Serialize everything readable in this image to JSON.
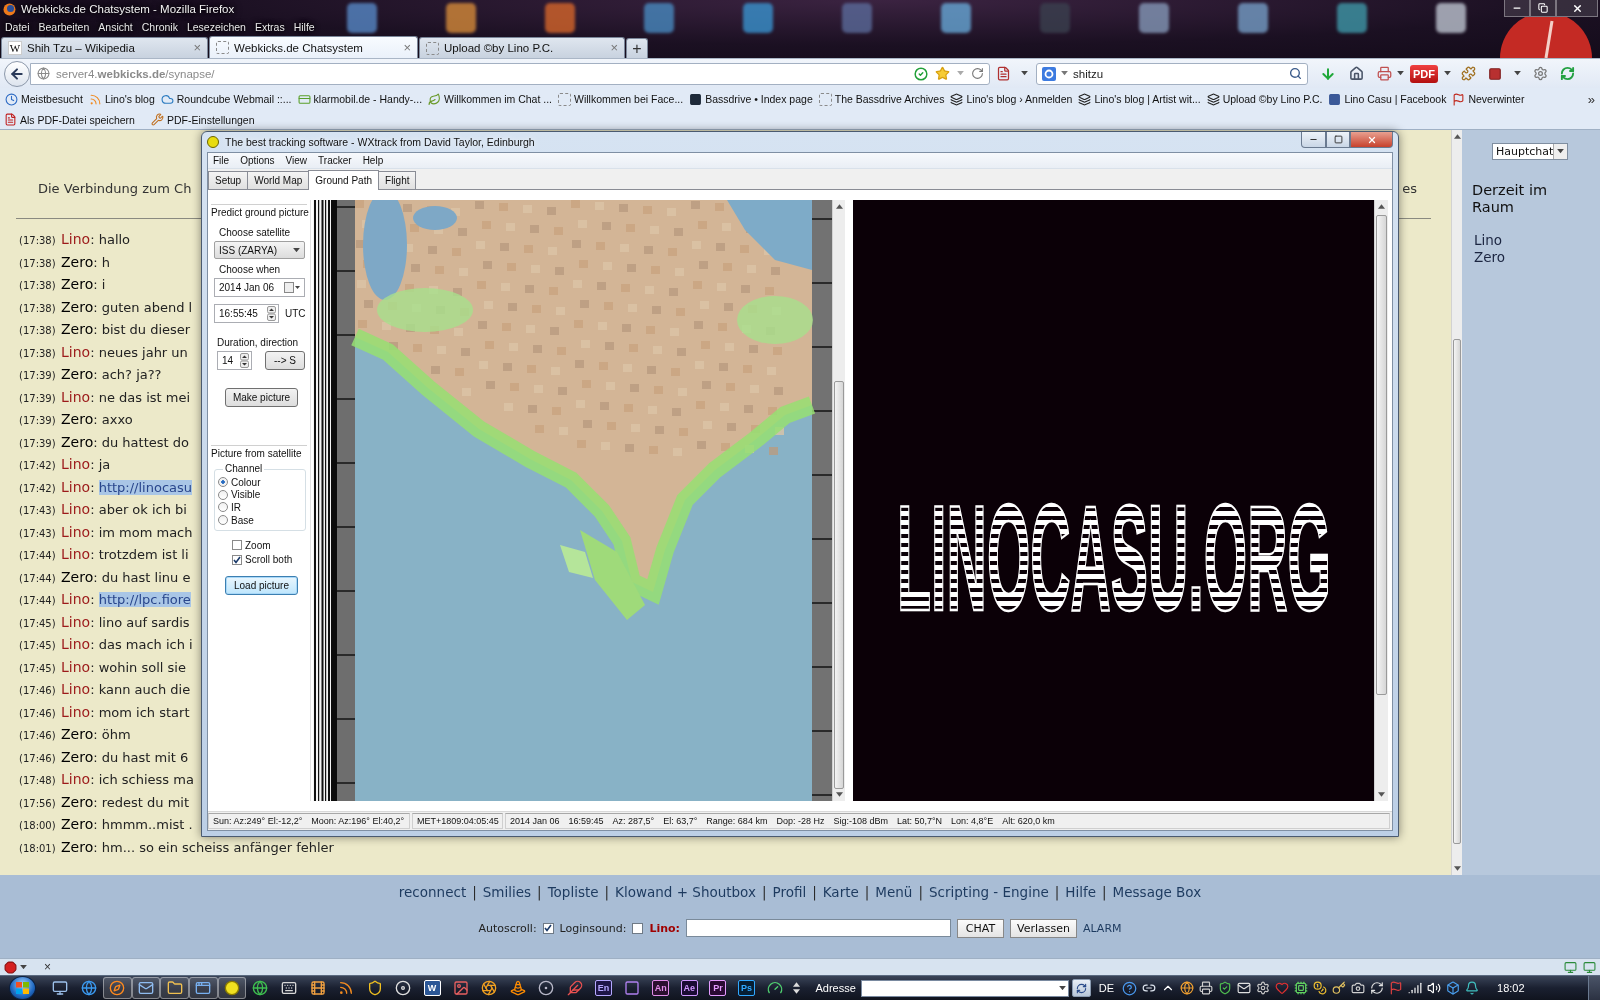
{
  "window": {
    "title": "Webkicks.de Chatsystem - Mozilla Firefox"
  },
  "menu": [
    "Datei",
    "Bearbeiten",
    "Ansicht",
    "Chronik",
    "Lesezeichen",
    "Extras",
    "Hilfe"
  ],
  "tabs": [
    {
      "favicon": "W",
      "label": "Shih Tzu – Wikipedia",
      "close": "×",
      "selected": false
    },
    {
      "label": "Webkicks.de Chatsystem",
      "close": "×",
      "selected": true
    },
    {
      "label": "Upload ©by Lino P.C.",
      "close": "×",
      "selected": false
    }
  ],
  "new_tab": "+",
  "address_bar": {
    "url": "server4.**webkicks.de**/synapse/"
  },
  "search": {
    "value": "shitzu"
  },
  "toolbar": {
    "pdf_badge": "PDF"
  },
  "bookmarks": {
    "items": [
      "Meistbesucht",
      "Lino's blog",
      "Roundcube Webmail ::...",
      "klarmobil.de - Handy-...",
      "Willkommen im Chat ...",
      "Willkommen bei Face...",
      "Bassdrive • Index page",
      "The Bassdrive Archives",
      "Lino's blog › Anmelden",
      "Lino's blog | Artist wit...",
      "Upload ©by Lino P.C.",
      "Lino Casu | Facebook",
      "Neverwinter"
    ],
    "more": "»"
  },
  "pdf_toolbar": [
    "Als PDF-Datei speichern",
    "PDF-Einstellungen"
  ],
  "chat": {
    "notice": [
      "Die Verbindung zum Ch",
      "es"
    ],
    "separator": ":",
    "messages": [
      {
        "time": "(17:38)",
        "nick": "Lino",
        "color": "#9c1a1a",
        "kind": "text",
        "text": "hallo"
      },
      {
        "time": "(17:38)",
        "nick": "Zero",
        "color": "#000000",
        "kind": "text",
        "text": "h"
      },
      {
        "time": "(17:38)",
        "nick": "Zero",
        "color": "#000000",
        "kind": "text",
        "text": "i"
      },
      {
        "time": "(17:38)",
        "nick": "Zero",
        "color": "#000000",
        "kind": "text",
        "text": "guten abend l"
      },
      {
        "time": "(17:38)",
        "nick": "Zero",
        "color": "#000000",
        "kind": "text",
        "text": "bist du dieser"
      },
      {
        "time": "(17:38)",
        "nick": "Lino",
        "color": "#9c1a1a",
        "kind": "text",
        "text": "neues jahr un"
      },
      {
        "time": "(17:39)",
        "nick": "Zero",
        "color": "#000000",
        "kind": "text",
        "text": "ach? ja??"
      },
      {
        "time": "(17:39)",
        "nick": "Lino",
        "color": "#9c1a1a",
        "kind": "text",
        "text": "ne das ist mei"
      },
      {
        "time": "(17:39)",
        "nick": "Zero",
        "color": "#000000",
        "kind": "text",
        "text": "axxo"
      },
      {
        "time": "(17:39)",
        "nick": "Zero",
        "color": "#000000",
        "kind": "text",
        "text": "du hattest do"
      },
      {
        "time": "(17:42)",
        "nick": "Lino",
        "color": "#9c1a1a",
        "kind": "text",
        "text": "ja"
      },
      {
        "time": "(17:42)",
        "nick": "Lino",
        "color": "#9c1a1a",
        "kind": "link",
        "text": "http://linocasu"
      },
      {
        "time": "(17:43)",
        "nick": "Lino",
        "color": "#9c1a1a",
        "kind": "text",
        "text": "aber ok ich bi"
      },
      {
        "time": "(17:43)",
        "nick": "Lino",
        "color": "#9c1a1a",
        "kind": "text",
        "text": "im mom mach"
      },
      {
        "time": "(17:44)",
        "nick": "Lino",
        "color": "#9c1a1a",
        "kind": "text",
        "text": "trotzdem ist li"
      },
      {
        "time": "(17:44)",
        "nick": "Zero",
        "color": "#000000",
        "kind": "text",
        "text": "du hast linu e"
      },
      {
        "time": "(17:44)",
        "nick": "Lino",
        "color": "#9c1a1a",
        "kind": "link",
        "text": "http://lpc.fiore"
      },
      {
        "time": "(17:45)",
        "nick": "Lino",
        "color": "#9c1a1a",
        "kind": "text",
        "text": "lino auf sardis"
      },
      {
        "time": "(17:45)",
        "nick": "Lino",
        "color": "#9c1a1a",
        "kind": "text",
        "text": "das mach ich i"
      },
      {
        "time": "(17:45)",
        "nick": "Lino",
        "color": "#9c1a1a",
        "kind": "text",
        "text": "wohin soll sie"
      },
      {
        "time": "(17:46)",
        "nick": "Lino",
        "color": "#9c1a1a",
        "kind": "text",
        "text": "kann auch die"
      },
      {
        "time": "(17:46)",
        "nick": "Lino",
        "color": "#9c1a1a",
        "kind": "text",
        "text": "mom ich start"
      },
      {
        "time": "(17:46)",
        "nick": "Zero",
        "color": "#000000",
        "kind": "text",
        "text": "öhm"
      },
      {
        "time": "(17:46)",
        "nick": "Zero",
        "color": "#000000",
        "kind": "text",
        "text": "du hast mit 6"
      },
      {
        "time": "(17:48)",
        "nick": "Lino",
        "color": "#9c1a1a",
        "kind": "text",
        "text": "ich schiess ma"
      },
      {
        "time": "(17:56)",
        "nick": "Zero",
        "color": "#000000",
        "kind": "text",
        "text": "redest du mit"
      },
      {
        "time": "(18:00)",
        "nick": "Zero",
        "color": "#000000",
        "kind": "text",
        "text": "hmmm..mist ."
      },
      {
        "time": "(18:01)",
        "nick": "Zero",
        "color": "#000000",
        "kind": "text",
        "text": "hm... so ein scheiss anfänger fehler"
      }
    ]
  },
  "sidebar": {
    "room": "Hauptchat",
    "heading": "Derzeit im Raum",
    "users": [
      "Lino",
      "Zero"
    ]
  },
  "footer": {
    "links": [
      "reconnect",
      "Smilies",
      "Topliste",
      "Klowand + Shoutbox",
      "Profil",
      "Karte",
      "Menü",
      "Scripting - Engine",
      "Hilfe",
      "Message Box"
    ],
    "separator": "|",
    "options": [
      {
        "label": "Autoscroll:",
        "checked": true
      },
      {
        "label": "Loginsound:",
        "checked": false
      }
    ],
    "nick": "Lino:",
    "buttons": [
      "CHAT",
      "Verlassen"
    ],
    "alarm": "ALARM"
  },
  "app_window": {
    "title": "The best tracking software - WXtrack from David Taylor, Edinburgh",
    "menu": [
      "File",
      "Options",
      "View",
      "Tracker",
      "Help"
    ],
    "tabs": [
      {
        "label": "Setup",
        "selected": false
      },
      {
        "label": "World Map",
        "selected": false
      },
      {
        "label": "Ground Path",
        "selected": true
      },
      {
        "label": "Flight",
        "selected": false
      }
    ],
    "predict": {
      "heading": "Predict ground picture",
      "satellite_label": "Choose satellite",
      "satellite": "ISS (ZARYA)",
      "when_label": "Choose when",
      "date": "2014 Jan 06",
      "time": "16:55:45",
      "time_zone": "UTC",
      "duration_label": "Duration, direction",
      "duration": "14",
      "direction": "--> S",
      "make_button": "Make picture"
    },
    "from_satellite": {
      "heading": "Picture from satellite",
      "channel_label": "Channel",
      "channels": [
        {
          "label": "Colour",
          "selected": true
        },
        {
          "label": "Visible",
          "selected": false
        },
        {
          "label": "IR",
          "selected": false
        },
        {
          "label": "Base",
          "selected": false
        }
      ],
      "options": [
        {
          "label": "Zoom",
          "checked": false
        },
        {
          "label": "Scroll both",
          "checked": true
        }
      ],
      "load_button": "Load picture"
    },
    "picture": {
      "text": "LINOCASU.ORG"
    },
    "status_bar": [
      [
        "Sun: Az:249° El:-12,2°",
        "Moon: Az:196° El:40,2°"
      ],
      [
        "MET+1809:04:05:45"
      ],
      [
        "2014 Jan 06",
        "16:59:45",
        "Az: 287,5°",
        "El: 63,7°",
        "Range: 684 km",
        "Dop: -28 Hz",
        "Sig:-108 dBm",
        "Lat: 50,7°N",
        "Lon: 4,8°E",
        "Alt: 620,0 km"
      ]
    ]
  },
  "addon_bar": {
    "close": "×"
  },
  "taskbar": {
    "buttons": [
      {
        "running": false
      },
      {
        "running": false
      },
      {
        "running": true
      },
      {
        "running": true
      },
      {
        "running": true
      },
      {
        "running": true
      },
      {
        "running": true
      },
      {
        "running": false
      },
      {
        "running": false
      },
      {
        "running": false
      },
      {
        "running": false
      },
      {
        "running": false
      },
      {
        "running": false
      },
      {
        "label": "W",
        "running": false
      },
      {
        "running": false
      },
      {
        "running": false
      },
      {
        "running": false
      },
      {
        "running": false
      },
      {
        "running": false
      },
      {
        "label": "En",
        "running": false
      },
      {
        "running": false
      },
      {
        "label": "An",
        "running": false
      },
      {
        "label": "Ae",
        "running": false
      },
      {
        "label": "Pr",
        "running": false
      },
      {
        "label": "Ps",
        "running": false
      },
      {
        "running": false
      }
    ],
    "address_label": "Adresse",
    "language": "DE",
    "clock": "18:02"
  }
}
